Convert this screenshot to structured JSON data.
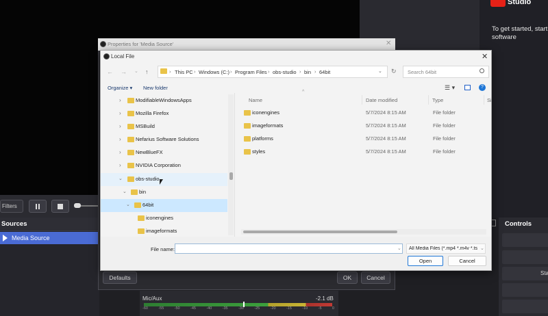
{
  "obs": {
    "brand": "Studio",
    "welcome_text": "To get started, start software",
    "filters_label": "Filters",
    "sources_title": "Sources",
    "source_item": "Media Source",
    "controls_title": "Controls",
    "controls_start": "Sta",
    "mixer": {
      "track": "Mic/Aux",
      "level": "-2.1 dB",
      "ticks": [
        "-60",
        "-55",
        "-50",
        "-45",
        "-40",
        "-35",
        "-30",
        "-25",
        "-20",
        "-15",
        "-10",
        "-5",
        "0"
      ]
    }
  },
  "properties": {
    "title": "Properties for 'Media Source'",
    "defaults": "Defaults",
    "ok": "OK",
    "cancel": "Cancel"
  },
  "file_dialog": {
    "title": "Local File",
    "breadcrumb": [
      "This PC",
      "Windows (C:)",
      "Program Files",
      "obs-studio",
      "bin",
      "64bit"
    ],
    "search_placeholder": "Search 64bit",
    "organize": "Organize",
    "new_folder": "New folder",
    "tree": [
      {
        "label": "ModifiableWindowsApps",
        "level": 1,
        "expanded": false
      },
      {
        "label": "Mozilla Firefox",
        "level": 1,
        "expanded": false
      },
      {
        "label": "MSBuild",
        "level": 1,
        "expanded": false
      },
      {
        "label": "Nefarius Software Solutions",
        "level": 1,
        "expanded": false
      },
      {
        "label": "NewBlueFX",
        "level": 1,
        "expanded": false
      },
      {
        "label": "NVIDIA Corporation",
        "level": 1,
        "expanded": false
      },
      {
        "label": "obs-studio",
        "level": 1,
        "expanded": true
      },
      {
        "label": "bin",
        "level": 2,
        "expanded": true
      },
      {
        "label": "64bit",
        "level": 3,
        "expanded": true,
        "selected": true
      },
      {
        "label": "iconengines",
        "level": 4
      },
      {
        "label": "imageformats",
        "level": 4
      }
    ],
    "columns": [
      "Name",
      "Date modified",
      "Type",
      "Si"
    ],
    "files": [
      {
        "name": "iconengines",
        "date": "5/7/2024 8:15 AM",
        "type": "File folder"
      },
      {
        "name": "imageformats",
        "date": "5/7/2024 8:15 AM",
        "type": "File folder"
      },
      {
        "name": "platforms",
        "date": "5/7/2024 8:15 AM",
        "type": "File folder"
      },
      {
        "name": "styles",
        "date": "5/7/2024 8:15 AM",
        "type": "File folder"
      }
    ],
    "file_name_label": "File name:",
    "file_name_value": "",
    "file_type": "All Media Files (*.mp4 *.m4v *.ts",
    "open": "Open",
    "cancel": "Cancel"
  },
  "colors": {
    "accent": "#1e76d6",
    "source_selected": "#4a6bd4",
    "folder": "#e9c349",
    "tree_selected": "#cce8ff"
  }
}
